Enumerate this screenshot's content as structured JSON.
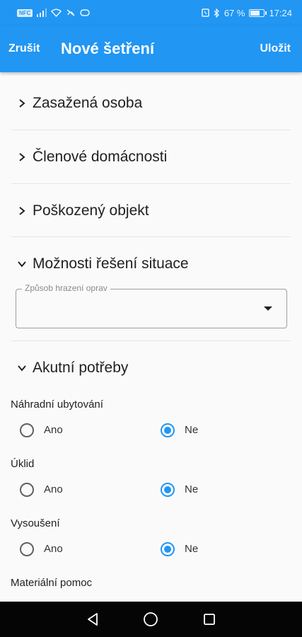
{
  "status_bar": {
    "nfc_label": "NFC",
    "battery_text": "67 %",
    "battery_level": 0.67,
    "time": "17:24"
  },
  "app_bar": {
    "cancel_label": "Zrušit",
    "title": "Nové šetření",
    "save_label": "Uložit",
    "color": "#2196f3"
  },
  "sections": [
    {
      "label": "Zasažená osoba",
      "expanded": false
    },
    {
      "label": "Členové domácnosti",
      "expanded": false
    },
    {
      "label": "Poškozený objekt",
      "expanded": false
    },
    {
      "label": "Možnosti řešení situace",
      "expanded": true
    },
    {
      "label": "Akutní potřeby",
      "expanded": true
    }
  ],
  "payment_select": {
    "legend": "Způsob hrazení oprav",
    "value": ""
  },
  "questions": [
    {
      "label": "Náhradní ubytování",
      "option_yes": "Ano",
      "option_no": "Ne",
      "selected": "Ne"
    },
    {
      "label": "Úklid",
      "option_yes": "Ano",
      "option_no": "Ne",
      "selected": "Ne"
    },
    {
      "label": "Vysoušení",
      "option_yes": "Ano",
      "option_no": "Ne",
      "selected": "Ne"
    },
    {
      "label": "Materiální pomoc"
    }
  ],
  "nav_bar": {
    "back_icon": "back-triangle-icon",
    "home_icon": "home-circle-icon",
    "recents_icon": "recents-square-icon"
  }
}
